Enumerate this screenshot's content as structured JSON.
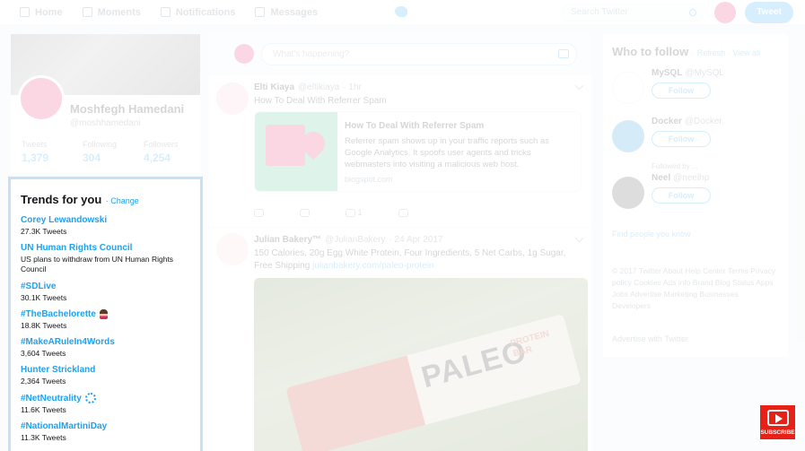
{
  "nav": {
    "items": [
      "Home",
      "Moments",
      "Notifications",
      "Messages"
    ],
    "search_placeholder": "Search Twitter",
    "tweet_button": "Tweet"
  },
  "profile": {
    "name": "Moshfegh Hamedani",
    "handle": "@moshhamedani",
    "stats": [
      {
        "label": "Tweets",
        "value": "1,379"
      },
      {
        "label": "Following",
        "value": "304"
      },
      {
        "label": "Followers",
        "value": "4,254"
      }
    ]
  },
  "compose": {
    "placeholder": "What's happening?"
  },
  "tweets": [
    {
      "name": "Elti Kiaya",
      "handle": "@eltikiaya",
      "time": "· 1hr",
      "text": "How To Deal With Referrer Spam",
      "card": {
        "title": "How To Deal With Referrer Spam",
        "desc": "Referrer spam shows up in your traffic reports such as Google Analytics. It spoofs user agents and tricks webmasters into visiting a malicious web host.",
        "domain": "blogspot.com"
      },
      "actions": [
        "",
        "",
        "1",
        ""
      ]
    },
    {
      "name": "Julian Bakery™",
      "handle": "@JulianBakery",
      "time": "· 24 Apr 2017",
      "text": "150 Calories, 20g Egg White Protein, Four Ingredients, 5 Net Carbs, 1g Sugar, Free Shipping",
      "link": "julianbakery.com/paleo-protein",
      "media_label": "PALEO",
      "media_sub": "PROTEIN BAR"
    }
  ],
  "who_to_follow": {
    "title": "Who to follow",
    "links": "· Refresh · View all",
    "accounts": [
      {
        "name": "MySQL",
        "handle": "@MySQL",
        "context": "",
        "button": "Follow"
      },
      {
        "name": "Docker",
        "handle": "@Docker",
        "context": "",
        "button": "Follow"
      },
      {
        "name": "Neel",
        "handle": "@neelhp",
        "context": "Followed by ...",
        "button": "Follow"
      }
    ],
    "find_friends": "Find people you know",
    "footer": "© 2017 Twitter About Help Center Terms Privacy policy Cookies Ads info Brand Blog Status Apps Jobs Advertise Marketing Businesses Developers",
    "ads": "Advertise with Twitter"
  },
  "trends": {
    "title": "Trends for you",
    "change": "· Change",
    "items": [
      {
        "name": "Corey Lewandowski",
        "count": "27.3K Tweets",
        "desc": ""
      },
      {
        "name": "UN Human Rights Council",
        "count": "",
        "desc": "US plans to withdraw from UN Human Rights Council"
      },
      {
        "name": "#SDLive",
        "count": "30.1K Tweets",
        "desc": ""
      },
      {
        "name": "#TheBachelorette",
        "count": "18.8K Tweets",
        "desc": ""
      },
      {
        "name": "#MakeARuleIn4Words",
        "count": "3,604 Tweets",
        "desc": ""
      },
      {
        "name": "Hunter Strickland",
        "count": "2,364 Tweets",
        "desc": ""
      },
      {
        "name": "#NetNeutrality",
        "count": "11.6K Tweets",
        "desc": ""
      },
      {
        "name": "#NationalMartiniDay",
        "count": "11.3K Tweets",
        "desc": ""
      }
    ]
  },
  "subscribe": {
    "label": "SUBSCRIBE"
  },
  "colors": {
    "accent": "#1da1f2",
    "brand_red": "#e0245e",
    "subscribe_red": "#e62117"
  }
}
